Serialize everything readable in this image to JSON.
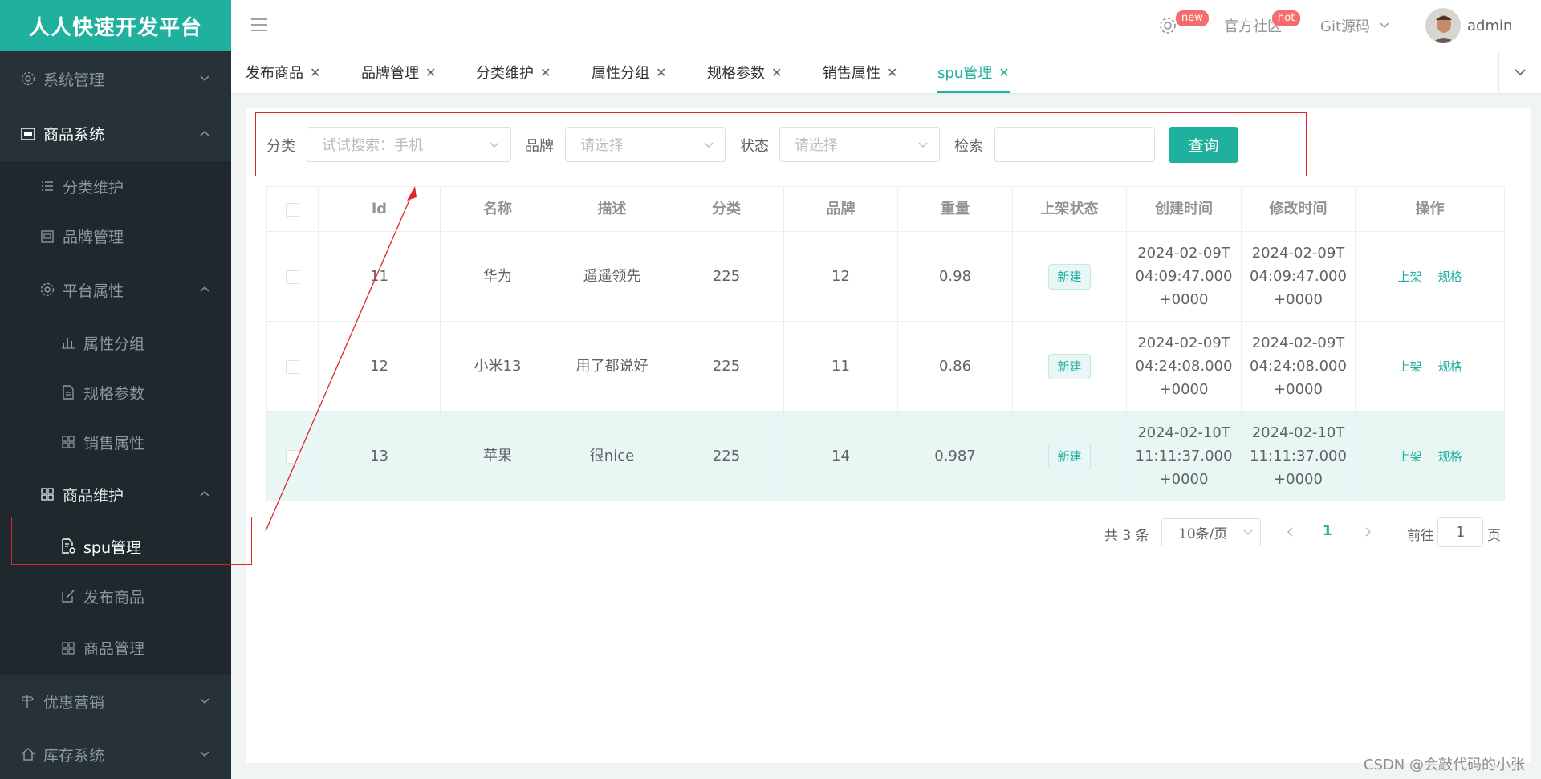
{
  "app": {
    "title": "人人快速开发平台"
  },
  "sidebar": {
    "system": "系统管理",
    "goods_system": "商品系统",
    "category": "分类维护",
    "brand": "品牌管理",
    "platform_attr": "平台属性",
    "attr_group": "属性分组",
    "spec_param": "规格参数",
    "sale_attr": "销售属性",
    "goods_maint": "商品维护",
    "spu": "spu管理",
    "publish": "发布商品",
    "goods_manage": "商品管理",
    "promo": "优惠营销",
    "stock": "库存系统"
  },
  "header": {
    "badge_new": "new",
    "community": "官方社区",
    "badge_hot": "hot",
    "git": "Git源码",
    "user": "admin"
  },
  "tabs": [
    {
      "label": "发布商品"
    },
    {
      "label": "品牌管理"
    },
    {
      "label": "分类维护"
    },
    {
      "label": "属性分组"
    },
    {
      "label": "规格参数"
    },
    {
      "label": "销售属性"
    },
    {
      "label": "spu管理"
    }
  ],
  "search": {
    "category_label": "分类",
    "category_placeholder": "试试搜索：手机",
    "brand_label": "品牌",
    "brand_placeholder": "请选择",
    "status_label": "状态",
    "status_placeholder": "请选择",
    "keyword_label": "检索",
    "keyword_value": "",
    "query_button": "查询"
  },
  "table": {
    "headers": [
      "id",
      "名称",
      "描述",
      "分类",
      "品牌",
      "重量",
      "上架状态",
      "创建时间",
      "修改时间",
      "操作"
    ],
    "rows": [
      {
        "id": "11",
        "name": "华为",
        "desc": "遥遥领先",
        "category": "225",
        "brand": "12",
        "weight": "0.98",
        "status": "新建",
        "created": "2024-02-09T04:09:47.000+0000",
        "updated": "2024-02-09T04:09:47.000+0000"
      },
      {
        "id": "12",
        "name": "小米13",
        "desc": "用了都说好",
        "category": "225",
        "brand": "11",
        "weight": "0.86",
        "status": "新建",
        "created": "2024-02-09T04:24:08.000+0000",
        "updated": "2024-02-09T04:24:08.000+0000"
      },
      {
        "id": "13",
        "name": "苹果",
        "desc": "很nice",
        "category": "225",
        "brand": "14",
        "weight": "0.987",
        "status": "新建",
        "created": "2024-02-10T11:11:37.000+0000",
        "updated": "2024-02-10T11:11:37.000+0000"
      }
    ],
    "op_shelf": "上架",
    "op_spec": "规格"
  },
  "pagination": {
    "total": "共 3 条",
    "page_size": "10条/页",
    "current": "1",
    "goto_label": "前往",
    "goto_value": "1",
    "page_suffix": "页"
  },
  "watermark": "CSDN @会敲代码的小张",
  "colors": {
    "accent": "#1fb19e",
    "sidebar": "#263238",
    "annotation": "#e0252b"
  }
}
